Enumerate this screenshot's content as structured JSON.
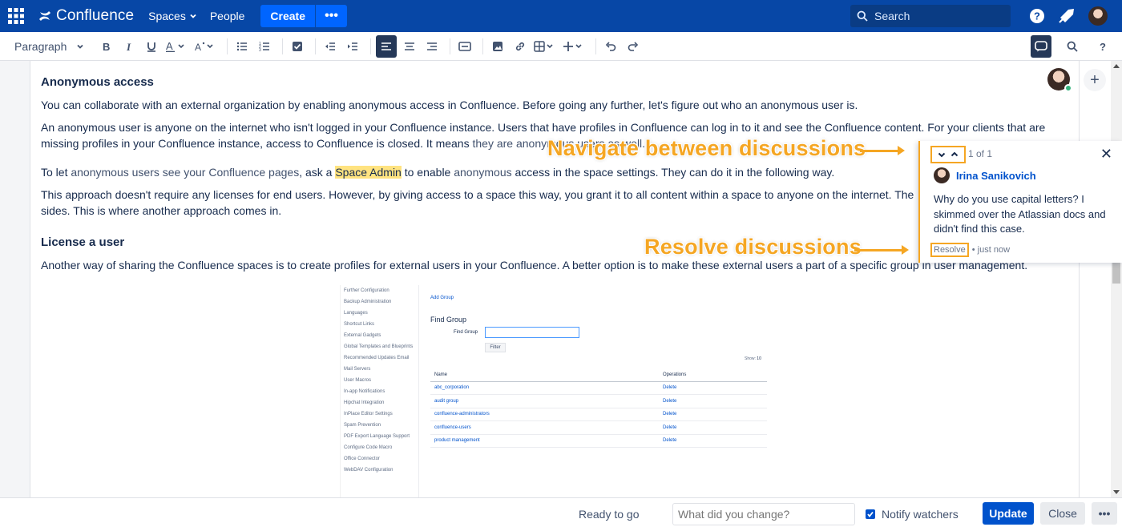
{
  "topnav": {
    "logo_text": "Confluence",
    "spaces": "Spaces",
    "people": "People",
    "create": "Create",
    "more": "•••",
    "search_placeholder": "Search"
  },
  "toolbar": {
    "paragraph": "Paragraph"
  },
  "content": {
    "heading1": "Anonymous access",
    "p1": "You can collaborate with an external organization by enabling anonymous access in Confluence. Before going any further, let's figure out who an anonymous user is.",
    "p2a": "An anonymous user is anyone on the internet who isn't logged in your Confluence instance. Users that have profiles in Confluence can log in to it and see the Confluence content. For your clients that are missing profiles in your Confluence instance, access to Confluence is closed. It means ",
    "p2b": "they are anonymous users as well.",
    "p3a": "To let ",
    "p3b": "anonymous users see your Confluence pages",
    "p3c": ", ask a ",
    "p3d": "Space Admin",
    "p3e": " to enable ",
    "p3f": "anonymous",
    "p3g": " access in the space settings. They can do it in the following way.",
    "p4a": "This approach doesn't require any licenses for end users. However, by giving access to a space this way, you grant it to all content within a space to anyone on the internet. The information shared",
    "p4b": "sides. This is where another approach comes in.",
    "heading2": "License a user",
    "p5": "Another way of sharing the Confluence spaces is to create profiles for external users in your Confluence. A better option is to make these external users a part of a specific group in user management."
  },
  "embed": {
    "sidebar": [
      "Further Configuration",
      "Backup Administration",
      "Languages",
      "Shortcut Links",
      "External Gadgets",
      "Global Templates and Blueprints",
      "Recommended Updates Email",
      "Mail Servers",
      "User Macros",
      "In-app Notifications",
      "Hipchat Integration",
      "InPlace Editor Settings",
      "Spam Prevention",
      "PDF Export Language Support",
      "Configure Code Macro",
      "Office Connector",
      "WebDAV Configuration"
    ],
    "add_group": "Add Group",
    "find_group_title": "Find Group",
    "find_group_label": "Find Group",
    "filter": "Filter",
    "show": "Show:",
    "show_count": "10",
    "col_name": "Name",
    "col_operations": "Operations",
    "rows": [
      {
        "name": "abc_corporation",
        "op": "Delete"
      },
      {
        "name": "audit group",
        "op": "Delete"
      },
      {
        "name": "confluence-administrators",
        "op": "Delete"
      },
      {
        "name": "confluence-users",
        "op": "Delete"
      },
      {
        "name": "product management",
        "op": "Delete"
      }
    ]
  },
  "comment": {
    "count": "1 of 1",
    "author": "Irina Sanikovich",
    "body": "Why do you use capital letters? I skimmed over the Atlassian docs and didn't find this case.",
    "resolve": "Resolve",
    "time": "• just now"
  },
  "callouts": {
    "navigate": "Navigate between discussions",
    "resolve": "Resolve discussions"
  },
  "bottombar": {
    "status": "Ready to go",
    "change_placeholder": "What did you change?",
    "notify": "Notify watchers",
    "update": "Update",
    "close": "Close",
    "more": "•••"
  },
  "colors": {
    "nav_bg": "#0747a6",
    "accent": "#0052cc",
    "highlight": "#ffe380",
    "callout": "#f5a623"
  }
}
